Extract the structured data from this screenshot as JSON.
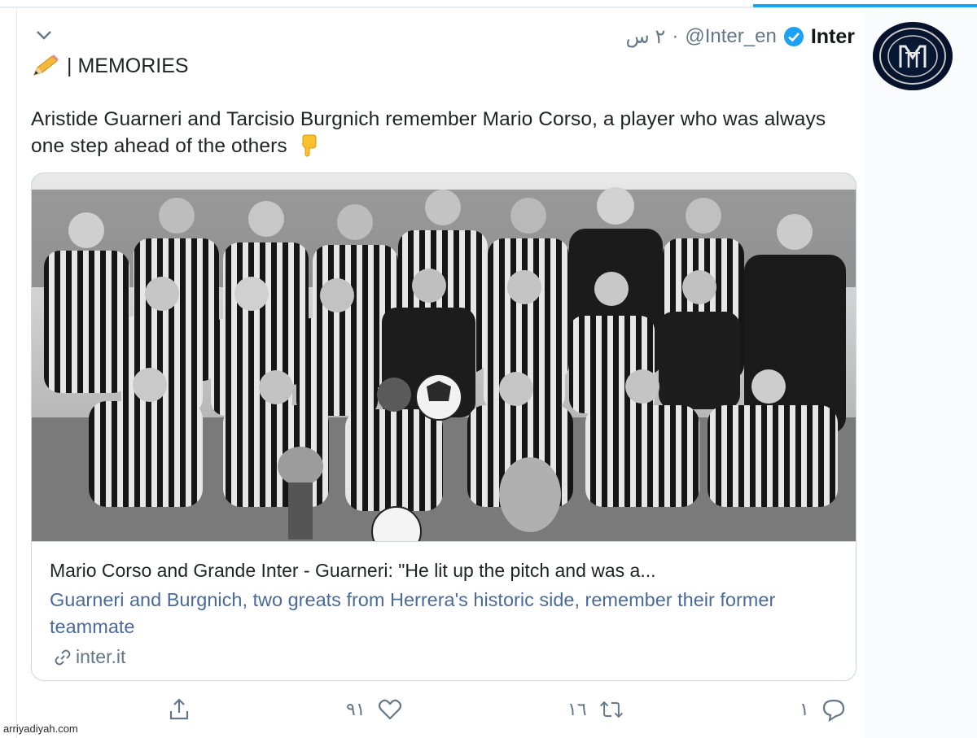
{
  "tweet": {
    "display_name": "Inter",
    "handle": "@Inter_en",
    "separator": "·",
    "time": "٢ س",
    "category": "| MEMORIES",
    "text": "Aristide Guarneri and Tarcisio Burgnich remember Mario Corso, a player who was always one step ahead of the others",
    "icons": {
      "pencil": "pencil-emoji",
      "pointing": "backhand-index-pointing-down-emoji",
      "verified": "verified-badge-icon",
      "menu": "chevron-down-icon"
    }
  },
  "card": {
    "title": "Mario Corso and Grande Inter - Guarneri: \"He lit up the pitch and was a...",
    "description": "Guarneri and Burgnich, two greats from Herrera's historic side, remember their former teammate",
    "domain": "inter.it",
    "image_alt": "Black and white team photo of Grande Inter"
  },
  "actions": {
    "reply_count": "١",
    "retweet_count": "١٦",
    "like_count": "٩١",
    "share": ""
  },
  "watermark": "arriyadiyah.com",
  "colors": {
    "accent": "#1da1f2",
    "link": "#4a6a9a",
    "muted": "#657786"
  }
}
